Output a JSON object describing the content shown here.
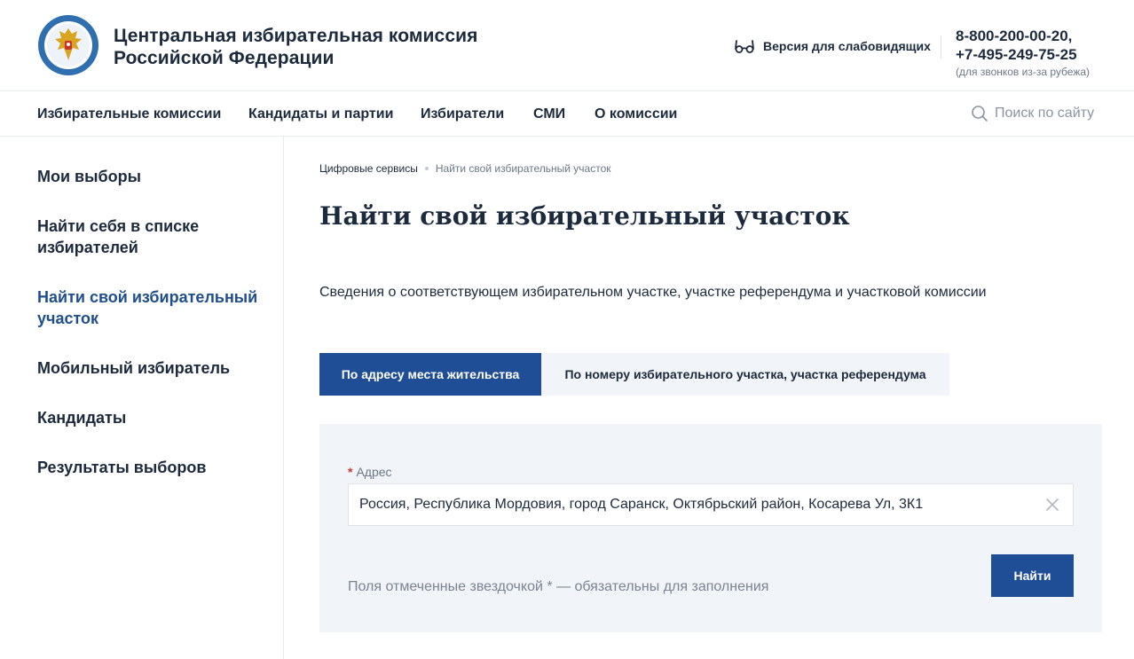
{
  "header": {
    "org_name_line1": "Центральная избирательная комиссия",
    "org_name_line2": "Российской Федерации",
    "low_vision_label": "Версия для слабовидящих",
    "phone1": "8-800-200-00-20,",
    "phone2": "+7-495-249-75-25",
    "phone_note": "(для звонков из-за рубежа)",
    "logo_icon": "cec-emblem-icon",
    "low_vision_icon": "glasses-icon"
  },
  "topnav": {
    "items": [
      "Избирательные комиссии",
      "Кандидаты и партии",
      "Избиратели",
      "СМИ",
      "О комиссии"
    ],
    "search_placeholder": "Поиск по сайту",
    "search_icon": "search-icon"
  },
  "sidebar": {
    "items": [
      {
        "label": "Мои выборы",
        "active": false
      },
      {
        "label": "Найти себя в списке избирателей",
        "active": false
      },
      {
        "label": "Найти свой избирательный участок",
        "active": true
      },
      {
        "label": "Мобильный избиратель",
        "active": false
      },
      {
        "label": "Кандидаты",
        "active": false
      },
      {
        "label": "Результаты выборов",
        "active": false
      }
    ]
  },
  "main": {
    "breadcrumb": [
      "Цифровые сервисы",
      "Найти свой избирательный участок"
    ],
    "title": "Найти свой избирательный участок",
    "description": "Сведения о соответствующем избирательном участке, участке референдума и участковой комиссии",
    "tabs": [
      {
        "label": "По адресу места жительства",
        "active": true
      },
      {
        "label": "По номеру избирательного участка, участка референдума",
        "active": false
      }
    ],
    "form": {
      "required_mark": "*",
      "address_label": "Адрес",
      "address_value": "Россия, Республика Мордовия, город Саранск, Октябрьский район, Косарева Ул, 3К1",
      "clear_icon": "close-icon",
      "hint": "Поля отмеченные звездочкой * — обязательны для заполнения",
      "submit_label": "Найти"
    }
  },
  "colors": {
    "primary": "#1f4e97",
    "text": "#1b2a3d",
    "muted": "#6b7788",
    "panel_bg": "#f1f4f8",
    "required": "#d0342c"
  }
}
